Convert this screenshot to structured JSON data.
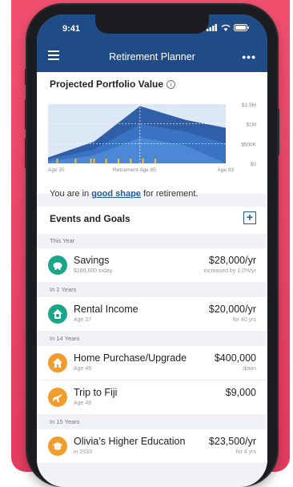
{
  "status_bar": {
    "time": "9:41"
  },
  "app_bar": {
    "title": "Retirement Planner",
    "menu_icon": "hamburger-icon",
    "more_label": "•••"
  },
  "portfolio": {
    "title": "Projected Portfolio Value",
    "info_symbol": "i",
    "y_ticks": [
      "$1.5M",
      "$1M",
      "$500K",
      "$0"
    ],
    "x_labels": [
      "Age 35",
      "Retirement Age 65",
      "Age 93"
    ]
  },
  "message": {
    "prefix": "You are in ",
    "highlight": "good shape",
    "suffix": " for retirement."
  },
  "events": {
    "title": "Events and Goals",
    "add_label": "+",
    "groups": [
      {
        "label": "This Year",
        "items": [
          {
            "title": "Savings",
            "sub": "$189,000 today",
            "value": "$28,000/yr",
            "note": "increased by 1.0%/yr",
            "icon": "piggy-bank-icon",
            "color": "#1aa58a"
          }
        ]
      },
      {
        "label": "In 2 Years",
        "items": [
          {
            "title": "Rental Income",
            "sub": "Age 37",
            "value": "$20,000/yr",
            "note": "for 40 yrs",
            "icon": "house-dollar-icon",
            "color": "#1aa58a"
          }
        ]
      },
      {
        "label": "In 14 Years",
        "items": [
          {
            "title": "Home Purchase/Upgrade",
            "sub": "Age 49",
            "value": "$400,000",
            "note": "down",
            "icon": "house-icon",
            "color": "#f29c2b"
          },
          {
            "title": "Trip to Fiji",
            "sub": "Age 49",
            "value": "$9,000",
            "note": "",
            "icon": "airplane-icon",
            "color": "#f29c2b"
          }
        ]
      },
      {
        "label": "In 15 Years",
        "items": [
          {
            "title": "Olivia’s Higher Education",
            "sub": "in 2033",
            "value": "$23,500/yr",
            "note": "for 4 yrs",
            "icon": "graduation-cap-icon",
            "color": "#f29c2b"
          }
        ]
      }
    ]
  },
  "chart_data": {
    "type": "area",
    "x_labels": [
      "Age 35",
      "Retirement Age 65",
      "Age 93"
    ],
    "y_ticks": [
      "$1.5M",
      "$1M",
      "$500K",
      "$0"
    ],
    "ylim": [
      0,
      1500000
    ],
    "series": [
      {
        "x": [
          35,
          50,
          65,
          80,
          93
        ],
        "values": [
          150000,
          550000,
          1450000,
          1100000,
          900000
        ]
      },
      {
        "x": [
          35,
          50,
          65,
          80,
          93
        ],
        "values": [
          100000,
          350000,
          1000000,
          800000,
          500000
        ]
      },
      {
        "x": [
          35,
          50,
          65,
          80,
          93
        ],
        "values": [
          50000,
          200000,
          650000,
          450000,
          0
        ]
      }
    ],
    "markers_x": [
      38,
      44,
      49,
      50,
      54,
      58,
      62,
      66,
      70
    ]
  }
}
